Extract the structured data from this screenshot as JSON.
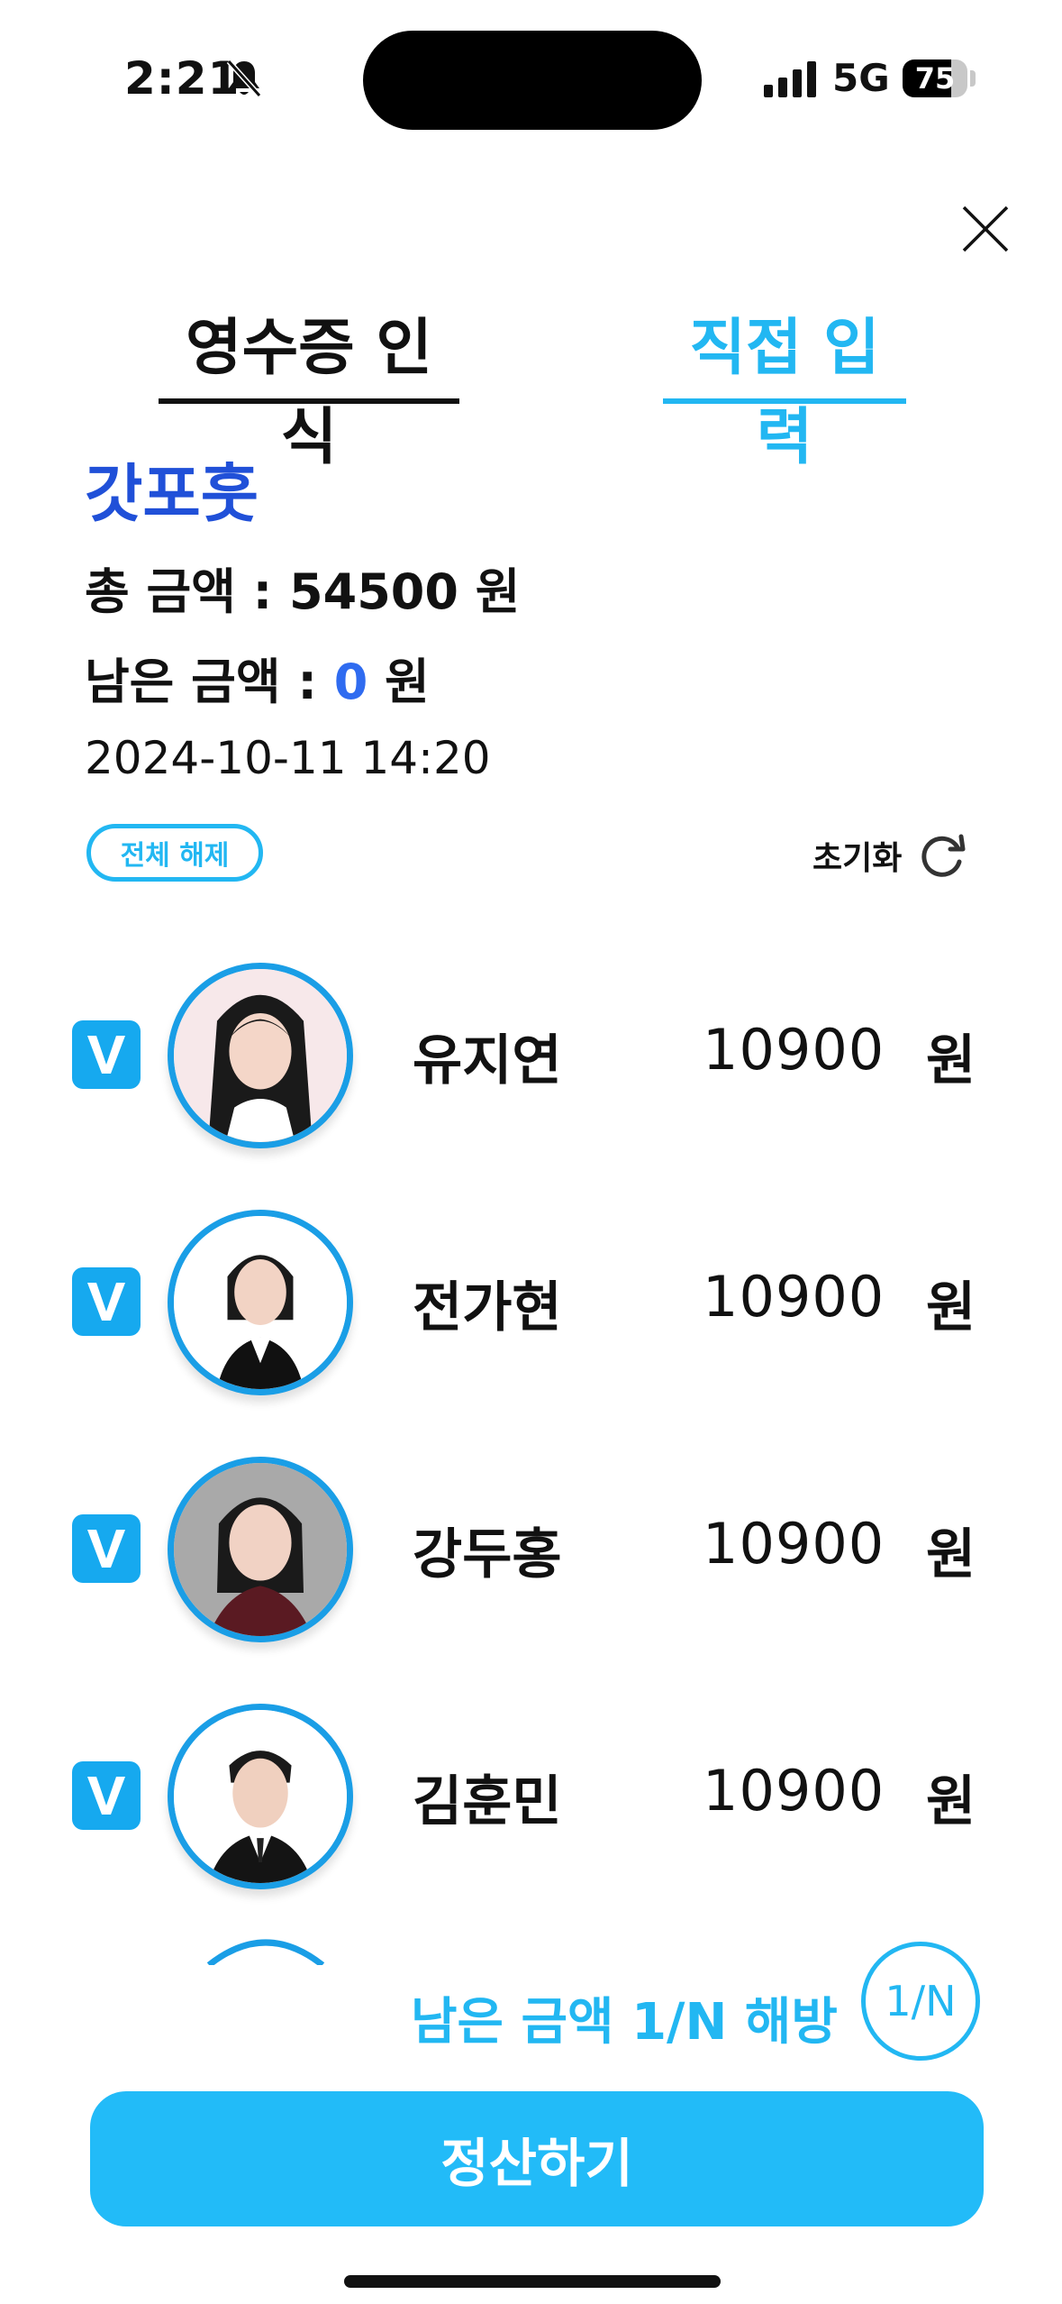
{
  "status_bar": {
    "time": "2:21",
    "network": "5G",
    "battery_level": "75",
    "battery_fraction": 0.75
  },
  "tabs": [
    {
      "label": "영수증 인식"
    },
    {
      "label": "직접 입력"
    }
  ],
  "summary": {
    "store_name": "갓포훗",
    "total_prefix": "총 금액 : ",
    "total_amount": "54500",
    "unit": " 원",
    "remain_prefix": "남은 금액 : ",
    "remain_amount": "0",
    "datetime": "2024-10-11 14:20"
  },
  "actions": {
    "clear_all": "전체 해제",
    "reset": "초기화"
  },
  "members": [
    {
      "name": "유지연",
      "amount": "10900",
      "unit": "원",
      "checked": true
    },
    {
      "name": "전가현",
      "amount": "10900",
      "unit": "원",
      "checked": true
    },
    {
      "name": "강두홍",
      "amount": "10900",
      "unit": "원",
      "checked": true
    },
    {
      "name": "김훈민",
      "amount": "10900",
      "unit": "원",
      "checked": true
    }
  ],
  "split": {
    "label": "남은 금액 1/N 해방",
    "button": "1/N"
  },
  "submit_label": "정산하기",
  "colors": {
    "accent": "#22b7f2",
    "store": "#2050d8",
    "remain": "#2f6bf0",
    "checkbox": "#16a9ef"
  }
}
